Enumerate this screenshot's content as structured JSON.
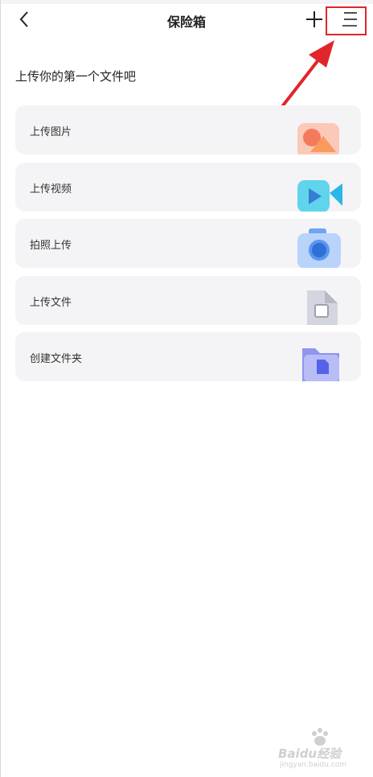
{
  "header": {
    "title": "保险箱",
    "back_icon": "chevron-left-icon",
    "add_icon": "plus-icon",
    "menu_icon": "menu-lines-icon"
  },
  "section_title": "上传你的第一个文件吧",
  "actions": [
    {
      "label": "上传图片",
      "icon": "image-icon"
    },
    {
      "label": "上传视频",
      "icon": "video-camera-icon"
    },
    {
      "label": "拍照上传",
      "icon": "camera-icon"
    },
    {
      "label": "上传文件",
      "icon": "document-icon"
    },
    {
      "label": "创建文件夹",
      "icon": "folder-icon"
    }
  ],
  "annotation": {
    "color": "#e0262a"
  },
  "watermark": {
    "text": "Baidu经验",
    "sub": "jingyan.baidu.com"
  }
}
